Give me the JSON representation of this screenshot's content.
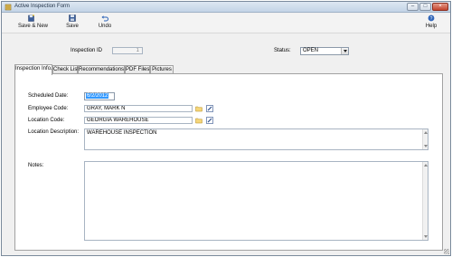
{
  "window": {
    "title": "Active Inspection Form"
  },
  "toolbar": {
    "save_new_label": "Save & New",
    "save_label": "Save",
    "undo_label": "Undo",
    "help_label": "Help"
  },
  "header": {
    "inspection_id_label": "Inspection ID",
    "inspection_id_value": "1",
    "status_label": "Status:",
    "status_value": "OPEN"
  },
  "tabs": [
    {
      "label": "Inspection Info."
    },
    {
      "label": "Check List"
    },
    {
      "label": "Recommendations"
    },
    {
      "label": "PDF Files"
    },
    {
      "label": "Pictures"
    }
  ],
  "active_tab": 0,
  "form": {
    "scheduled_date_label": "Scheduled Date:",
    "scheduled_date_value": "6/2/2012",
    "employee_code_label": "Employee Code:",
    "employee_code_value": "GRAY, MARK N",
    "location_code_label": "Location Code:",
    "location_code_value": "GEORGIA WAREHOUSE",
    "location_description_label": "Location Description:",
    "location_description_value": "WAREHOUSE INSPECTION",
    "notes_label": "Notes:",
    "notes_value": ""
  },
  "colors": {
    "accent": "#3399ff",
    "close_button": "#c2452f"
  }
}
